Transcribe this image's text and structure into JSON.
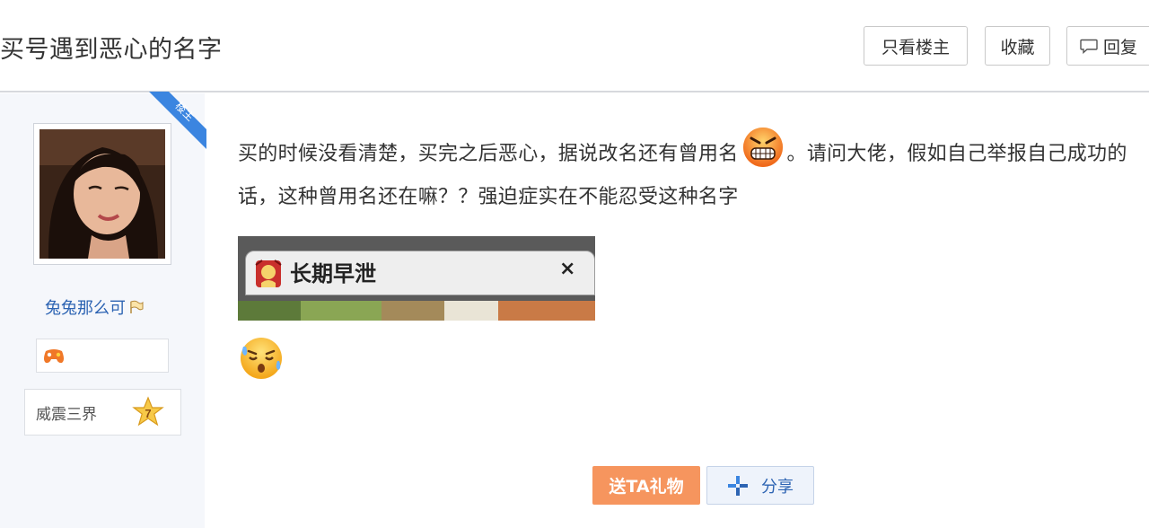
{
  "post": {
    "title": "买号遇到恶心的名字",
    "text_part1": "买的时候没看清楚，买完之后恶心，据说改名还有曾用名",
    "text_part2": "。请问大佬，假如自己举报自己成功的话，这种曾用名还在嘛？？强迫症实在不能忍受这种名字",
    "inline_emoji": "angry-face-icon",
    "end_emoji": "sweat-face-icon"
  },
  "toolbar": {
    "only_op_label": "只看楼主",
    "collect_label": "收藏",
    "reply_label": "回复"
  },
  "user": {
    "ribbon_label": "楼主",
    "name": "兔兔那么可",
    "level_name": "威震三界",
    "level_number": "7"
  },
  "screenshot": {
    "title": "长期早泄",
    "close_glyph": "×"
  },
  "actions": {
    "gift_label": "送TA礼物",
    "share_label": "分享"
  },
  "colors": {
    "accent_blue": "#2d64b3",
    "gift_orange": "#f6955e",
    "ribbon_blue": "#3b85e0",
    "sidebar_bg": "#f5f7fb"
  }
}
